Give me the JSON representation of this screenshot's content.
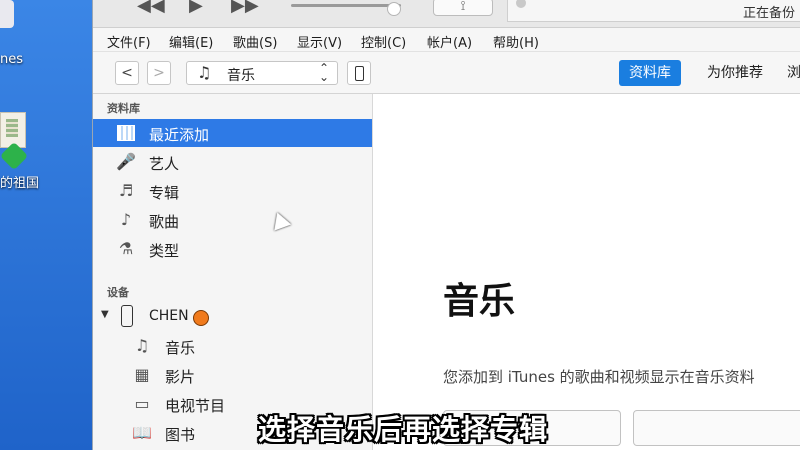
{
  "desktop": {
    "itunes_label": "nes",
    "folder_label": "的祖国"
  },
  "player": {
    "prev": "◀◀",
    "play": "▶",
    "next": "▶▶",
    "airplay": "⟟",
    "status_text": "正在备份"
  },
  "menu": {
    "items": [
      "文件(F)",
      "编辑(E)",
      "歌曲(S)",
      "显示(V)",
      "控制(C)",
      "帐户(A)",
      "帮助(H)"
    ]
  },
  "toolbar": {
    "back": "<",
    "forward": ">",
    "media_icon": "♫",
    "media_label": "音乐",
    "media_chevron": "⌃⌄",
    "tabs": [
      "资料库",
      "为你推荐",
      "浏"
    ]
  },
  "sidebar": {
    "library_title": "资料库",
    "library_items": [
      {
        "label": "最近添加",
        "icon": "recently-added-icon",
        "selected": true
      },
      {
        "label": "艺人",
        "icon": "microphone-icon",
        "glyph": "🎤"
      },
      {
        "label": "专辑",
        "icon": "album-icon",
        "glyph": "♬"
      },
      {
        "label": "歌曲",
        "icon": "note-icon",
        "glyph": "♪"
      },
      {
        "label": "类型",
        "icon": "genre-icon",
        "glyph": "⚗"
      }
    ],
    "devices_title": "设备",
    "device": {
      "name": "CHEN",
      "toggle": "▼"
    },
    "device_items": [
      {
        "label": "音乐",
        "icon": "music-note-icon",
        "glyph": "♫"
      },
      {
        "label": "影片",
        "icon": "film-icon",
        "glyph": "▦"
      },
      {
        "label": "电视节目",
        "icon": "tv-icon",
        "glyph": "▭"
      },
      {
        "label": "图书",
        "icon": "book-icon",
        "glyph": "📖"
      }
    ]
  },
  "main": {
    "title": "音乐",
    "description": "您添加到 iTunes 的歌曲和视频显示在音乐资料"
  },
  "caption": "选择音乐后再选择专辑",
  "colors": {
    "accent": "#1a7ee0",
    "selected_row": "#2e7ae6",
    "desktop": "#2a6fd6"
  }
}
